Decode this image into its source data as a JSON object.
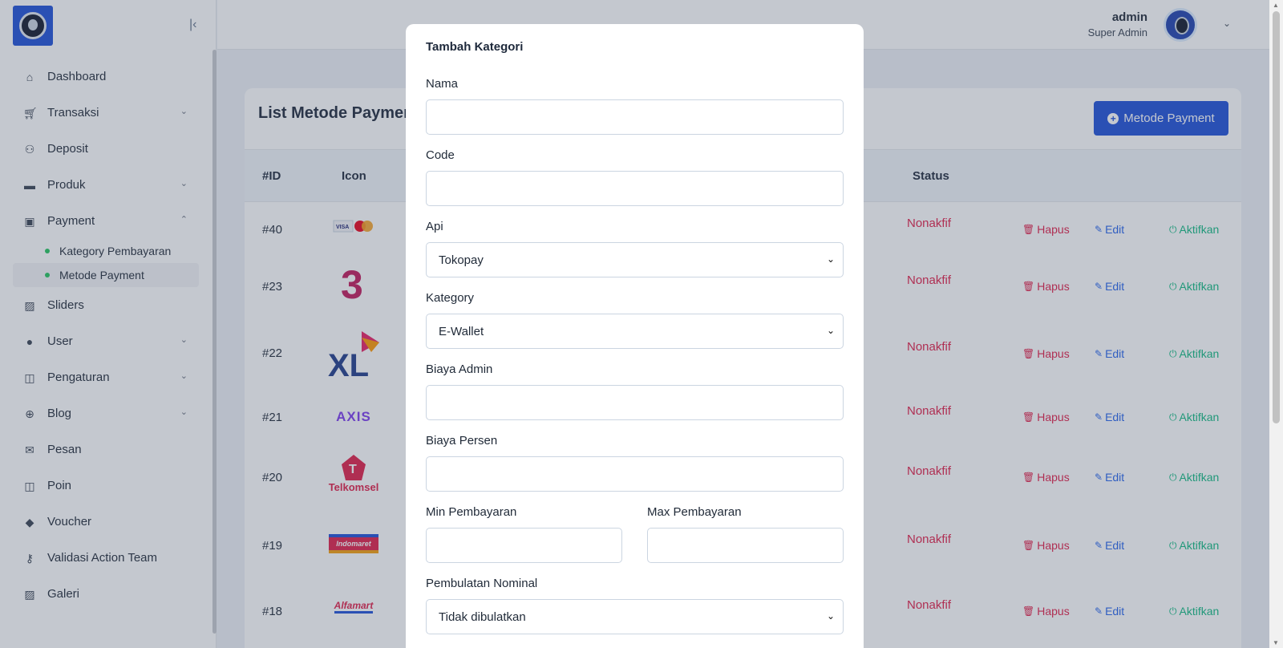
{
  "sidebar": {
    "collapse_icon": "collapse-left-icon",
    "items": [
      {
        "label": "Dashboard",
        "icon": "home-icon"
      },
      {
        "label": "Transaksi",
        "icon": "cart-icon",
        "chevron": "down"
      },
      {
        "label": "Deposit",
        "icon": "deposit-icon"
      },
      {
        "label": "Produk",
        "icon": "store-icon",
        "chevron": "down"
      },
      {
        "label": "Payment",
        "icon": "wallet-icon",
        "chevron": "up"
      },
      {
        "label": "Sliders",
        "icon": "image-icon"
      },
      {
        "label": "User",
        "icon": "user-icon",
        "chevron": "down"
      },
      {
        "label": "Pengaturan",
        "icon": "settings-panel-icon",
        "chevron": "down"
      },
      {
        "label": "Blog",
        "icon": "globe-icon",
        "chevron": "down"
      },
      {
        "label": "Pesan",
        "icon": "mail-icon"
      },
      {
        "label": "Poin",
        "icon": "points-icon"
      },
      {
        "label": "Voucher",
        "icon": "tag-icon"
      },
      {
        "label": "Validasi Action Team",
        "icon": "key-icon"
      },
      {
        "label": "Galeri",
        "icon": "gallery-icon"
      }
    ],
    "payment_sub": [
      {
        "label": "Kategory Pembayaran"
      },
      {
        "label": "Metode Payment"
      }
    ]
  },
  "header": {
    "user_name": "admin",
    "user_role": "Super Admin"
  },
  "card": {
    "title": "List Metode Payment",
    "add_button": "Metode Payment",
    "columns": {
      "id": "#ID",
      "icon": "Icon",
      "status": "Status"
    },
    "rows": [
      {
        "id": "#40",
        "logo": "visa-mastercard-logo",
        "status": "Nonakfif"
      },
      {
        "id": "#23",
        "logo": "three-logo",
        "status": "Nonakfif"
      },
      {
        "id": "#22",
        "logo": "xl-logo",
        "status": "Nonakfif"
      },
      {
        "id": "#21",
        "logo": "axis-logo",
        "status": "Nonakfif"
      },
      {
        "id": "#20",
        "logo": "telkomsel-logo",
        "status": "Nonakfif"
      },
      {
        "id": "#19",
        "logo": "indomaret-logo",
        "status": "Nonakfif"
      },
      {
        "id": "#18",
        "logo": "alfamart-logo",
        "status": "Nonakfif"
      }
    ],
    "actions": {
      "delete": "Hapus",
      "edit": "Edit",
      "activate": "Aktifkan"
    },
    "logo_text": {
      "axis": "AXIS",
      "telkomsel": "Telkomsel",
      "indomaret": "Indomaret",
      "alfamart": "Alfamart"
    }
  },
  "modal": {
    "title": "Tambah Kategori",
    "nama_label": "Nama",
    "nama_value": "",
    "code_label": "Code",
    "code_value": "",
    "api_label": "Api",
    "api_value": "Tokopay",
    "kategory_label": "Kategory",
    "kategory_value": "E-Wallet",
    "biaya_admin_label": "Biaya Admin",
    "biaya_admin_value": "",
    "biaya_persen_label": "Biaya Persen",
    "biaya_persen_value": "",
    "min_label": "Min Pembayaran",
    "min_value": "",
    "max_label": "Max Pembayaran",
    "max_value": "",
    "pembulatan_label": "Pembulatan Nominal",
    "pembulatan_value": "Tidak dibulatkan"
  },
  "colors": {
    "primary": "#1d4ed8",
    "danger": "#e11d48",
    "edit": "#2563eb",
    "success": "#10b981",
    "overlay": "rgba(71,85,105,0.32)"
  }
}
